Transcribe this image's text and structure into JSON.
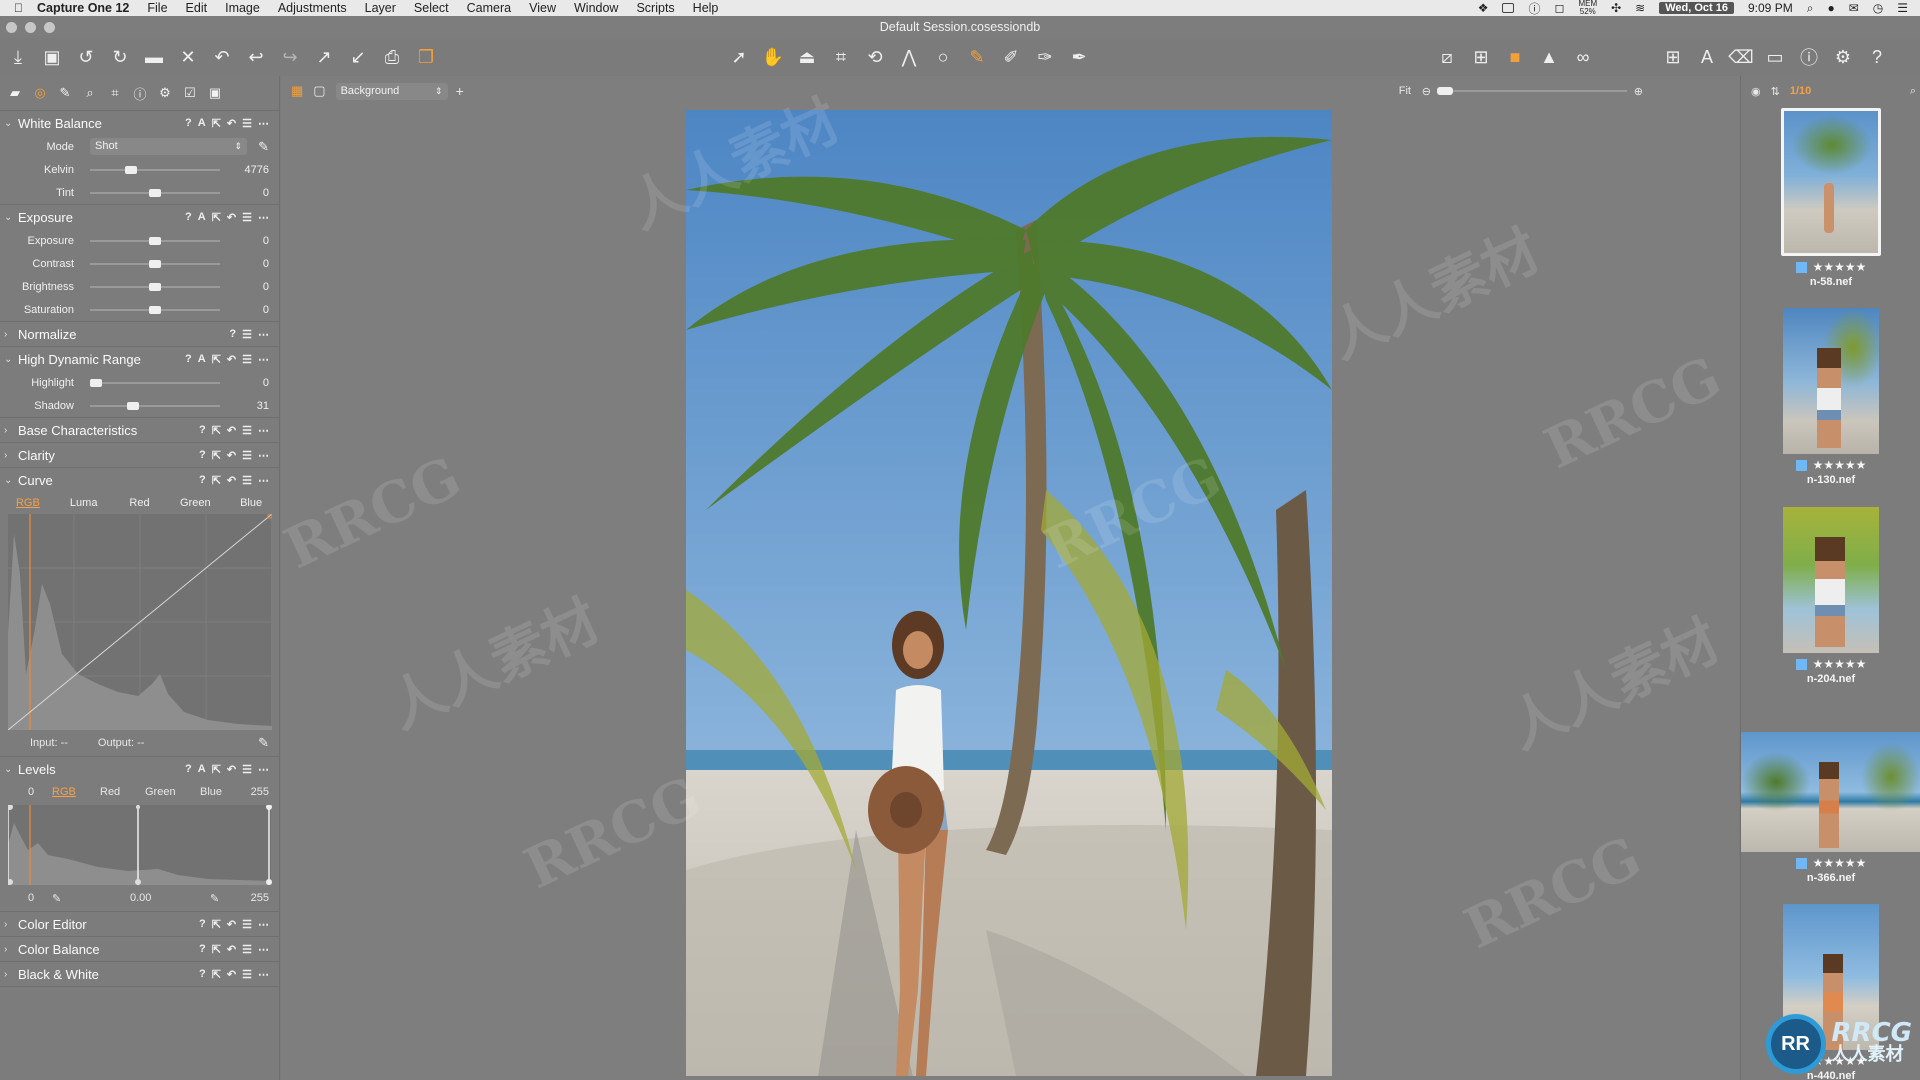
{
  "menubar": {
    "app_name": "Capture One 12",
    "menus": [
      "File",
      "Edit",
      "Image",
      "Adjustments",
      "Layer",
      "Select",
      "Camera",
      "View",
      "Window",
      "Scripts",
      "Help"
    ],
    "mem_label": "MEM",
    "mem_value": "52%",
    "date": "Wed, Oct 16",
    "time": "9:09 PM"
  },
  "window": {
    "title": "Default Session.cosessiondb"
  },
  "viewer": {
    "layer_select": "Background",
    "zoom_label": "Fit"
  },
  "browser": {
    "counter": "1/10"
  },
  "tools": {
    "white_balance": {
      "title": "White Balance",
      "mode_label": "Mode",
      "mode_value": "Shot",
      "sliders": [
        {
          "label": "Kelvin",
          "value": "4776",
          "pos": 0.3
        },
        {
          "label": "Tint",
          "value": "0",
          "pos": 0.5
        }
      ]
    },
    "exposure": {
      "title": "Exposure",
      "sliders": [
        {
          "label": "Exposure",
          "value": "0",
          "pos": 0.5
        },
        {
          "label": "Contrast",
          "value": "0",
          "pos": 0.5
        },
        {
          "label": "Brightness",
          "value": "0",
          "pos": 0.5
        },
        {
          "label": "Saturation",
          "value": "0",
          "pos": 0.5
        }
      ]
    },
    "normalize": {
      "title": "Normalize"
    },
    "hdr": {
      "title": "High Dynamic Range",
      "sliders": [
        {
          "label": "Highlight",
          "value": "0",
          "pos": 0.0
        },
        {
          "label": "Shadow",
          "value": "31",
          "pos": 0.31
        }
      ]
    },
    "base": {
      "title": "Base Characteristics"
    },
    "clarity": {
      "title": "Clarity"
    },
    "curve": {
      "title": "Curve",
      "channels": [
        "RGB",
        "Luma",
        "Red",
        "Green",
        "Blue"
      ],
      "input_label": "Input:",
      "input_value": "--",
      "output_label": "Output:",
      "output_value": "--"
    },
    "levels": {
      "title": "Levels",
      "channels": [
        "RGB",
        "Red",
        "Green",
        "Blue"
      ],
      "in_low": "0",
      "in_high": "255",
      "out_low": "0",
      "mid": "0.00",
      "out_high": "255"
    },
    "color_editor": {
      "title": "Color Editor"
    },
    "color_balance": {
      "title": "Color Balance"
    },
    "black_white": {
      "title": "Black & White"
    }
  },
  "thumbnails": [
    {
      "name": "n-58.nef",
      "stars": "★★★★★",
      "rating": 5
    },
    {
      "name": "n-130.nef",
      "stars": "★★★★★",
      "rating": 5
    },
    {
      "name": "n-204.nef",
      "stars": "★★★★★",
      "rating": 5
    },
    {
      "name": "n-366.nef",
      "stars": "★★★★★",
      "rating": 5
    },
    {
      "name": "n-440.nef",
      "stars": "★★★★★",
      "rating": 5
    }
  ],
  "watermark": {
    "text_a": "RRCG",
    "text_b": "人人素材"
  },
  "colors": {
    "accent": "#f2a03a",
    "tag_blue": "#6fb8f5",
    "panel": "#7c7c7c"
  }
}
